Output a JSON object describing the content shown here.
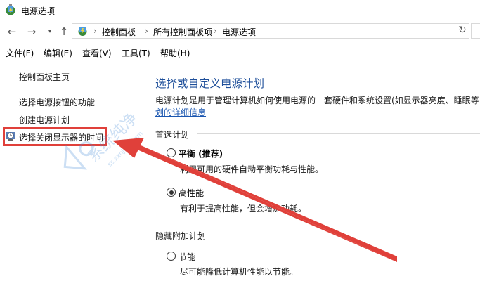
{
  "window": {
    "title": "电源选项"
  },
  "breadcrumb": {
    "items": [
      "控制面板",
      "所有控制面板项",
      "电源选项"
    ]
  },
  "menubar": {
    "items": [
      "文件(F)",
      "编辑(E)",
      "查看(V)",
      "工具(T)",
      "帮助(H)"
    ]
  },
  "sidebar": {
    "home": "控制面板主页",
    "links": [
      "选择电源按钮的功能",
      "创建电源计划",
      "选择关闭显示器的时间"
    ]
  },
  "main": {
    "title": "选择或自定义电源计划",
    "description": "电源计划是用于管理计算机如何使用电源的一套硬件和系统设置(如显示器亮度、睡眠等",
    "details_link": "划的详细信息",
    "preferred_label": "首选计划",
    "plans": [
      {
        "name": "平衡 (推荐)",
        "desc": "利用可用的硬件自动平衡功耗与性能。",
        "selected": false
      },
      {
        "name": "高性能",
        "desc": "有利于提高性能，但会增加功耗。",
        "selected": true
      }
    ],
    "hidden_label": "隐藏附加计划",
    "hidden_plans": [
      {
        "name": "节能",
        "desc": "尽可能降低计算机性能以节能。",
        "selected": false
      }
    ]
  },
  "icons": {
    "back": "arrow-left-icon",
    "forward": "arrow-right-icon",
    "recent": "chevron-down-icon",
    "up": "arrow-up-icon",
    "refresh": "refresh-icon",
    "power": "power-options-icon",
    "monitor": "monitor-clock-icon"
  },
  "colors": {
    "accent_title": "#1e4f9a",
    "link": "#1a56b0",
    "annotation_red": "#e0403a"
  }
}
